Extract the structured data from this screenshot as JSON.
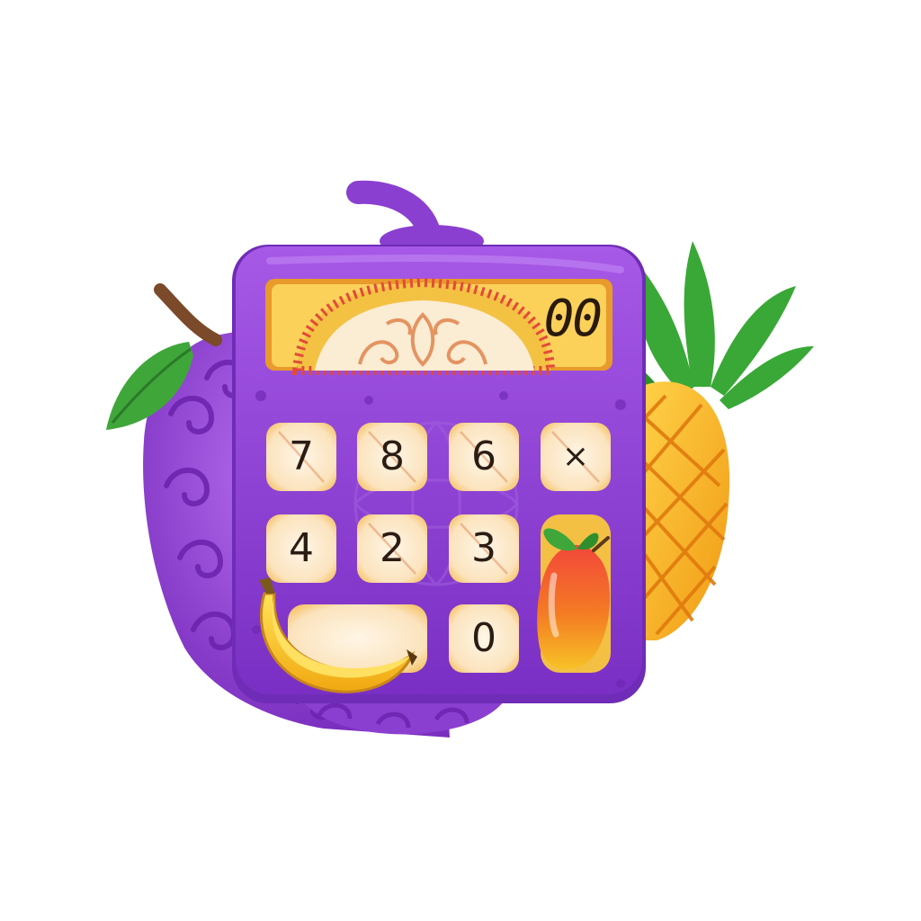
{
  "display": {
    "value": "00"
  },
  "keypad": {
    "row1": [
      "7",
      "8",
      "6",
      "×"
    ],
    "row2": [
      "4",
      "2",
      "3"
    ],
    "row3": [
      "0"
    ]
  },
  "colors": {
    "body": "#8a3fd0",
    "body_light": "#b56af0",
    "display_frame": "#f2b43a",
    "key_face": "#fbeed8",
    "leaf_green": "#3fa63a",
    "pineapple": "#f5b21e",
    "banana": "#f7c824",
    "mango": "#f05a28"
  },
  "icons": [
    "grape-icon",
    "pineapple-icon",
    "banana-icon",
    "mango-icon",
    "leaf-icon",
    "stem-icon"
  ]
}
